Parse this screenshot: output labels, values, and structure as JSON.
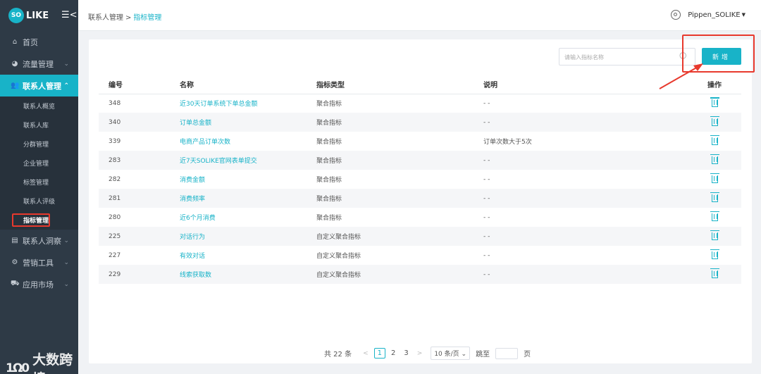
{
  "brand": {
    "logo_circle": "SO",
    "logo_text": "LIKE",
    "menu_toggle": "☰<"
  },
  "sidebar": {
    "items": [
      {
        "label": "首页",
        "icon": "home-icon",
        "glyph": "⌂"
      },
      {
        "label": "流量管理",
        "icon": "pie-chart-icon",
        "glyph": "◕"
      },
      {
        "label": "联系人管理",
        "icon": "users-icon",
        "glyph": "👥"
      },
      {
        "label": "联系人洞察",
        "icon": "id-card-icon",
        "glyph": "▤"
      },
      {
        "label": "营销工具",
        "icon": "gears-icon",
        "glyph": "⚙"
      },
      {
        "label": "应用市场",
        "icon": "cart-icon",
        "glyph": "⛟"
      }
    ],
    "sub_items": [
      "联系人概览",
      "联系人库",
      "分群管理",
      "企业管理",
      "标签管理",
      "联系人评级",
      "指标管理"
    ]
  },
  "watermark": {
    "icon": "1Ω0",
    "text": "大数跨境"
  },
  "breadcrumb": {
    "parent": "联系人管理",
    "sep": ">",
    "current": "指标管理"
  },
  "user": {
    "name": "Pippen_SOLIKE"
  },
  "search": {
    "placeholder": "请输入指标名称"
  },
  "toolbar": {
    "add_label": "新增"
  },
  "table": {
    "headers": [
      "编号",
      "名称",
      "指标类型",
      "说明",
      "操作"
    ],
    "rows": [
      {
        "id": "348",
        "name": "近30天订单系统下单总金额",
        "type": "聚合指标",
        "desc": "- -"
      },
      {
        "id": "340",
        "name": "订单总金额",
        "type": "聚合指标",
        "desc": "- -"
      },
      {
        "id": "339",
        "name": "电商产品订单次数",
        "type": "聚合指标",
        "desc": "订单次数大于5次"
      },
      {
        "id": "283",
        "name": "近7天SOLIKE官网表单提交",
        "type": "聚合指标",
        "desc": "- -"
      },
      {
        "id": "282",
        "name": "消费金额",
        "type": "聚合指标",
        "desc": "- -"
      },
      {
        "id": "281",
        "name": "消费频率",
        "type": "聚合指标",
        "desc": "- -"
      },
      {
        "id": "280",
        "name": "近6个月消费",
        "type": "聚合指标",
        "desc": "- -"
      },
      {
        "id": "225",
        "name": "对话行为",
        "type": "自定义聚合指标",
        "desc": "- -"
      },
      {
        "id": "227",
        "name": "有效对话",
        "type": "自定义聚合指标",
        "desc": "- -"
      },
      {
        "id": "229",
        "name": "线索获取数",
        "type": "自定义聚合指标",
        "desc": "- -"
      }
    ]
  },
  "pagination": {
    "total": "共 22 条",
    "prev": "<",
    "pages": [
      "1",
      "2",
      "3"
    ],
    "next": ">",
    "page_size": "10 条/页",
    "goto_label": "跳至",
    "page_unit": "页"
  },
  "colors": {
    "accent": "#18b3c8",
    "sidebar_bg": "#2e3a46",
    "highlight": "#e8392d"
  }
}
